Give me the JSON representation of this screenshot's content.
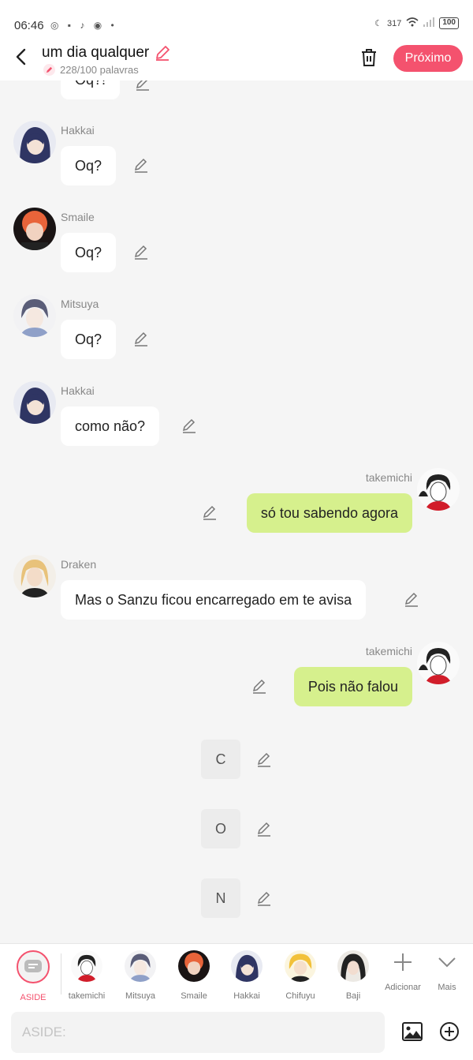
{
  "status_bar": {
    "time": "06:46",
    "network_speed": "317",
    "battery": "100"
  },
  "header": {
    "title": "um dia qualquer",
    "word_count": "228/100 palavras",
    "next_label": "Próximo"
  },
  "messages": {
    "partial": {
      "text": "Oq?!"
    },
    "m1": {
      "name": "Hakkai",
      "text": "Oq?"
    },
    "m2": {
      "name": "Smaile",
      "text": "Oq?"
    },
    "m3": {
      "name": "Mitsuya",
      "text": "Oq?"
    },
    "m4": {
      "name": "Hakkai",
      "text": "como não?"
    },
    "m5": {
      "name": "takemichi",
      "text": "só tou sabendo agora"
    },
    "m6": {
      "name": "Draken",
      "text": "Mas o Sanzu ficou encarregado em te avisa"
    },
    "m7": {
      "name": "takemichi",
      "text": "Pois não falou"
    },
    "a1": {
      "text": "C"
    },
    "a2": {
      "text": "O"
    },
    "a3": {
      "text": "N"
    }
  },
  "characters": {
    "aside": "ASIDE",
    "c1": "takemichi",
    "c2": "Mitsuya",
    "c3": "Smaile",
    "c4": "Hakkai",
    "c5": "Chifuyu",
    "c6": "Baji",
    "add": "Adicionar",
    "more": "Mais"
  },
  "input": {
    "placeholder": "ASIDE:"
  },
  "colors": {
    "accent": "#f4526e",
    "bubble_right": "#d6f08d",
    "bubble_left": "#ffffff",
    "background": "#f5f5f5"
  }
}
